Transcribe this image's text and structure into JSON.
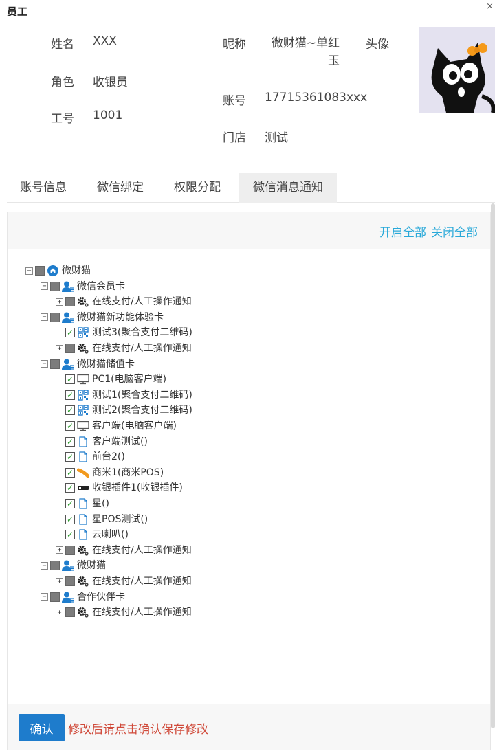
{
  "window": {
    "title": "员工",
    "close": "×"
  },
  "profile": {
    "name_label": "姓名",
    "name_value": "XXX",
    "role_label": "角色",
    "role_value": "收银员",
    "id_label": "工号",
    "id_value": "1001",
    "nick_label": "昵称",
    "nick_value": "微财猫~单红玉",
    "account_label": "账号",
    "account_value": "17715361083xxx",
    "store_label": "门店",
    "store_value": "测试",
    "avatar_label": "头像"
  },
  "tabs": [
    {
      "label": "账号信息",
      "active": false
    },
    {
      "label": "微信绑定",
      "active": false
    },
    {
      "label": "权限分配",
      "active": false
    },
    {
      "label": "微信消息通知",
      "active": true
    }
  ],
  "panel": {
    "open_all": "开启全部",
    "close_all": "关闭全部"
  },
  "tree": [
    {
      "level": 0,
      "toggle": "minus",
      "check": "partial",
      "icon": "home-icon",
      "label": "微财猫"
    },
    {
      "level": 1,
      "toggle": "minus",
      "check": "partial",
      "icon": "user-icon",
      "label": "微信会员卡"
    },
    {
      "level": 2,
      "toggle": "plus",
      "check": "partial",
      "icon": "gear-icon",
      "label": "在线支付/人工操作通知"
    },
    {
      "level": 1,
      "toggle": "minus",
      "check": "partial",
      "icon": "user-icon",
      "label": "微财猫新功能体验卡"
    },
    {
      "level": 2,
      "toggle": "none",
      "check": "checked",
      "icon": "qrcode-icon",
      "label": "测试3(聚合支付二维码)"
    },
    {
      "level": 2,
      "toggle": "plus",
      "check": "partial",
      "icon": "gear-icon",
      "label": "在线支付/人工操作通知"
    },
    {
      "level": 1,
      "toggle": "minus",
      "check": "partial",
      "icon": "user-icon",
      "label": "微财猫储值卡"
    },
    {
      "level": 2,
      "toggle": "none",
      "check": "checked",
      "icon": "monitor-icon",
      "label": "PC1(电脑客户端)"
    },
    {
      "level": 2,
      "toggle": "none",
      "check": "checked",
      "icon": "qrcode-icon",
      "label": "测试1(聚合支付二维码)"
    },
    {
      "level": 2,
      "toggle": "none",
      "check": "checked",
      "icon": "qrcode-icon",
      "label": "测试2(聚合支付二维码)"
    },
    {
      "level": 2,
      "toggle": "none",
      "check": "checked",
      "icon": "monitor-icon",
      "label": "客户端(电脑客户端)"
    },
    {
      "level": 2,
      "toggle": "none",
      "check": "checked",
      "icon": "document-icon",
      "label": "客户端测试()"
    },
    {
      "level": 2,
      "toggle": "none",
      "check": "checked",
      "icon": "document-icon",
      "label": "前台2()"
    },
    {
      "level": 2,
      "toggle": "none",
      "check": "checked",
      "icon": "pos-terminal-icon",
      "label": "商米1(商米POS)"
    },
    {
      "level": 2,
      "toggle": "none",
      "check": "checked",
      "icon": "plugin-icon",
      "label": "收银插件1(收银插件)"
    },
    {
      "level": 2,
      "toggle": "none",
      "check": "checked",
      "icon": "document-icon",
      "label": "星()"
    },
    {
      "level": 2,
      "toggle": "none",
      "check": "checked",
      "icon": "document-icon",
      "label": "星POS测试()"
    },
    {
      "level": 2,
      "toggle": "none",
      "check": "checked",
      "icon": "document-icon",
      "label": "云喇叭()"
    },
    {
      "level": 2,
      "toggle": "plus",
      "check": "partial",
      "icon": "gear-icon",
      "label": "在线支付/人工操作通知"
    },
    {
      "level": 1,
      "toggle": "minus",
      "check": "partial",
      "icon": "user-icon",
      "label": "微财猫"
    },
    {
      "level": 2,
      "toggle": "plus",
      "check": "partial",
      "icon": "gear-icon",
      "label": "在线支付/人工操作通知"
    },
    {
      "level": 1,
      "toggle": "minus",
      "check": "partial",
      "icon": "user-icon",
      "label": "合作伙伴卡"
    },
    {
      "level": 2,
      "toggle": "plus",
      "check": "partial",
      "icon": "gear-icon",
      "label": "在线支付/人工操作通知"
    }
  ],
  "footer": {
    "confirm": "确认",
    "hint": "修改后请点击确认保存修改"
  },
  "colors": {
    "accent": "#2aa9d9",
    "button": "#1e7ccc",
    "hint": "#d04a3a",
    "check": "#2a9a2a",
    "user_icon": "#1e7ccc"
  }
}
